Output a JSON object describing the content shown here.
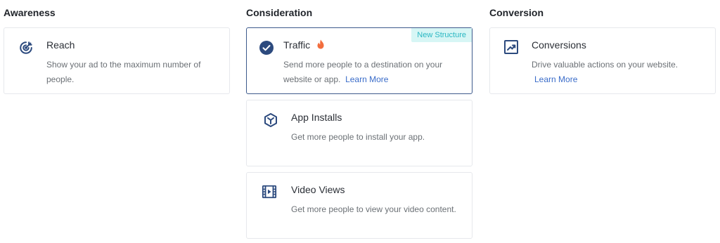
{
  "columns": {
    "awareness": {
      "title": "Awareness",
      "cards": [
        {
          "title": "Reach",
          "desc": "Show your ad to the maximum number of people.",
          "icon": "target-icon"
        }
      ]
    },
    "consideration": {
      "title": "Consideration",
      "cards": [
        {
          "title": "Traffic",
          "desc": "Send more people to a destination on your website or app.",
          "link": "Learn More",
          "badge": "New Structure",
          "icon": "check-circle-icon",
          "extra_icon": "flame-icon",
          "selected": true
        },
        {
          "title": "App Installs",
          "desc": "Get more people to install your app.",
          "icon": "cube-icon"
        },
        {
          "title": "Video Views",
          "desc": "Get more people to view your video content.",
          "icon": "film-icon"
        }
      ]
    },
    "conversion": {
      "title": "Conversion",
      "cards": [
        {
          "title": "Conversions",
          "desc": "Drive valuable actions on your website.",
          "link": "Learn More",
          "icon": "trend-chart-icon"
        }
      ]
    }
  },
  "colors": {
    "accent": "#2c4a7e",
    "selected_border": "#3d5a8c",
    "link": "#3a6cc9",
    "badge_text": "#29b7c2",
    "badge_bg": "#d7f6f5",
    "flame": "#f26d3d"
  }
}
